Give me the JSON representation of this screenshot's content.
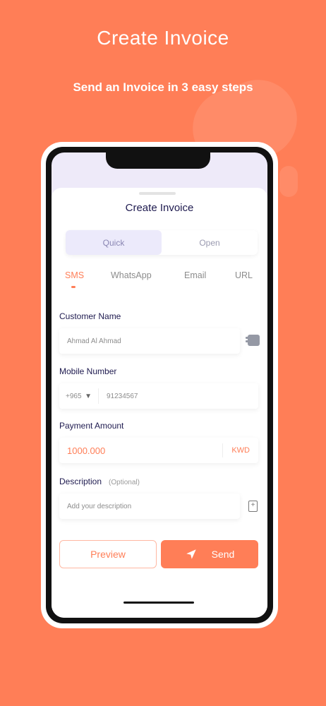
{
  "promo": {
    "headline": "Create Invoice",
    "subheadline": "Send an Invoice in 3 easy steps"
  },
  "sheet": {
    "title": "Create Invoice",
    "segments": [
      {
        "label": "Quick",
        "active": true
      },
      {
        "label": "Open",
        "active": false
      }
    ],
    "channels": [
      {
        "label": "SMS",
        "active": true
      },
      {
        "label": "WhatsApp",
        "active": false
      },
      {
        "label": "Email",
        "active": false
      },
      {
        "label": "URL",
        "active": false
      }
    ]
  },
  "form": {
    "customer_name": {
      "label": "Customer Name",
      "placeholder": "Ahmad Al Ahmad"
    },
    "mobile": {
      "label": "Mobile Number",
      "country_code": "+965",
      "placeholder": "91234567"
    },
    "amount": {
      "label": "Payment Amount",
      "value": "1000.000",
      "currency": "KWD"
    },
    "description": {
      "label": "Description",
      "optional": "(Optional)",
      "placeholder": "Add your description"
    }
  },
  "actions": {
    "preview": "Preview",
    "send": "Send"
  },
  "colors": {
    "brand": "#FF7E57",
    "title_text": "#1E1A4F",
    "segment_active_bg": "#ECEAFB"
  },
  "icons": {
    "contact": "contact-book-icon",
    "caret": "caret-down-icon",
    "attach": "document-add-icon",
    "send": "paper-plane-icon"
  }
}
